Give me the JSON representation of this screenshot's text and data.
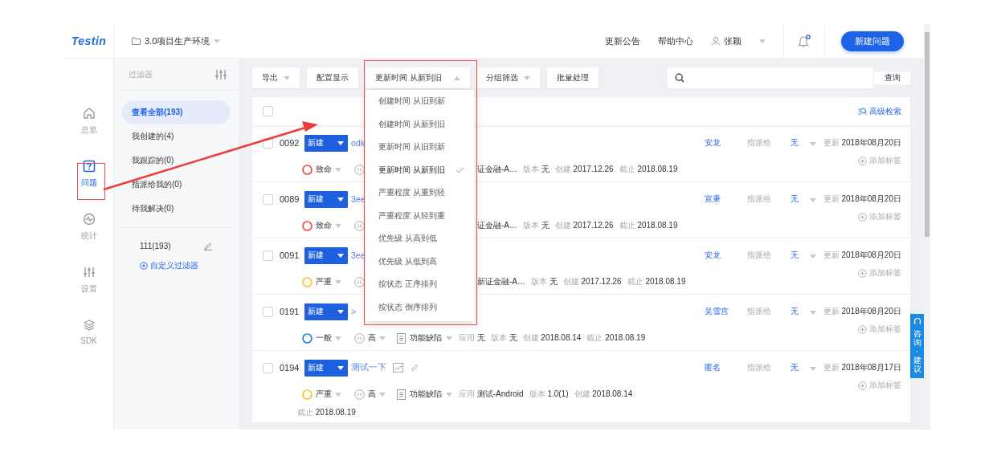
{
  "logo": "Testin",
  "nav": [
    {
      "label": "总览",
      "selected": false
    },
    {
      "label": "问题",
      "selected": true
    },
    {
      "label": "统计",
      "selected": false
    },
    {
      "label": "设置",
      "selected": false
    },
    {
      "label": "SDK",
      "selected": false
    }
  ],
  "project": "3.0项目生产环境",
  "header_links": [
    "更新公告",
    "帮助中心"
  ],
  "user": "张颖",
  "notifications": {
    "unread": true
  },
  "new_button": "新建问题",
  "filters": {
    "title": "过滤器",
    "items": [
      {
        "label": "查看全部(193)",
        "selected": true
      },
      {
        "label": "我创建的(4)",
        "selected": false
      },
      {
        "label": "我跟踪的(0)",
        "selected": false
      },
      {
        "label": "指派给我的(0)",
        "selected": false
      },
      {
        "label": "待我解决(0)",
        "selected": false
      }
    ],
    "saved": [
      "111(193)"
    ],
    "add": "自定义过滤器"
  },
  "toolbar": {
    "export": "导出",
    "config": "配置显示",
    "sort": {
      "label": "更新时间 从新到旧",
      "expanded": true
    },
    "group": "分组筛选",
    "batch": "批量处理",
    "search_button": "查询"
  },
  "sort_menu": [
    {
      "label": "创建时间 从旧到新",
      "selected": false
    },
    {
      "label": "创建时间 从新到旧",
      "selected": false
    },
    {
      "label": "更新时间 从旧到新",
      "selected": false
    },
    {
      "label": "更新时间 从新到旧",
      "selected": true
    },
    {
      "label": "严重程度 从重到轻",
      "selected": false
    },
    {
      "label": "严重程度 从轻到重",
      "selected": false
    },
    {
      "label": "优先级 从高到低",
      "selected": false
    },
    {
      "label": "优先级 从低到高",
      "selected": false
    },
    {
      "label": "按状态 正序排列",
      "selected": false
    },
    {
      "label": "按状态 倒序排列",
      "selected": false
    }
  ],
  "select_all": {
    "checked": false
  },
  "advanced_search": "高级检索",
  "issues": [
    {
      "checked": false,
      "id": "0092",
      "status": "新建",
      "title": "odk",
      "severity": {
        "text": "致命",
        "color": "#f04b3e"
      },
      "meta": [
        {
          "value": "证金融-A…"
        },
        {
          "label": "版本",
          "value": "无"
        },
        {
          "label": "创建",
          "value": "2017.12.26"
        },
        {
          "label": "截止",
          "value": "2018.08.19"
        }
      ],
      "reporter": "安龙",
      "assign_label": "指派给",
      "assignee": "无",
      "updated_label": "更新",
      "updated": "2018年08月20日",
      "tag": "添加标签"
    },
    {
      "checked": false,
      "id": "0089",
      "status": "新建",
      "title": "3ee",
      "severity": {
        "text": "致命",
        "color": "#f04b3e"
      },
      "meta": [
        {
          "value": "证金融-A…"
        },
        {
          "label": "版本",
          "value": "无"
        },
        {
          "label": "创建",
          "value": "2017.12.26"
        },
        {
          "label": "截止",
          "value": "2018.08.19"
        }
      ],
      "reporter": "宣秉",
      "assign_label": "指派给",
      "assignee": "无",
      "updated_label": "更新",
      "updated": "2018年08月20日",
      "tag": "添加标签"
    },
    {
      "checked": false,
      "id": "0091",
      "status": "新建",
      "title": "3ee",
      "severity": {
        "text": "严重",
        "color": "#f7c325"
      },
      "meta": [
        {
          "value": "新证金融-A…"
        },
        {
          "label": "版本",
          "value": "无"
        },
        {
          "label": "创建",
          "value": "2017.12.26"
        },
        {
          "label": "截止",
          "value": "2018.08.19"
        }
      ],
      "reporter": "安龙",
      "assign_label": "指派给",
      "assignee": "无",
      "updated_label": "更新",
      "updated": "2018年08月20日",
      "tag": "添加标签"
    },
    {
      "checked": false,
      "id": "0191",
      "status": "新建",
      "title": ">",
      "severity": {
        "text": "一般",
        "color": "#1b7fe6"
      },
      "priority": "高",
      "type": "功能缺陷",
      "meta": [
        {
          "label": "应用",
          "value": "无"
        },
        {
          "label": "版本",
          "value": "无"
        },
        {
          "label": "创建",
          "value": "2018.08.14"
        },
        {
          "label": "截止",
          "value": "2018.08.19"
        }
      ],
      "reporter": "吴雪宫",
      "assign_label": "指派给",
      "assignee": "无",
      "updated_label": "更新",
      "updated": "2018年08月20日",
      "tag": "添加标签"
    },
    {
      "checked": false,
      "id": "0194",
      "status": "新建",
      "title": "测试一下",
      "attachments": true,
      "severity": {
        "text": "严重",
        "color": "#f7c325"
      },
      "priority": "高",
      "type": "功能缺陷",
      "meta": [
        {
          "label": "应用",
          "value": "测试-Android"
        },
        {
          "label": "版本",
          "value": "1.0(1)"
        },
        {
          "label": "创建",
          "value": "2018.08.14"
        }
      ],
      "meta_line2": [
        {
          "label": "截止",
          "value": "2018.08.19"
        }
      ],
      "reporter": "匿名",
      "assign_label": "指派给",
      "assignee": "无",
      "updated_label": "更新",
      "updated": "2018年08月17日",
      "tag": "添加标签"
    }
  ],
  "feedback_tab": "咨询·建议"
}
